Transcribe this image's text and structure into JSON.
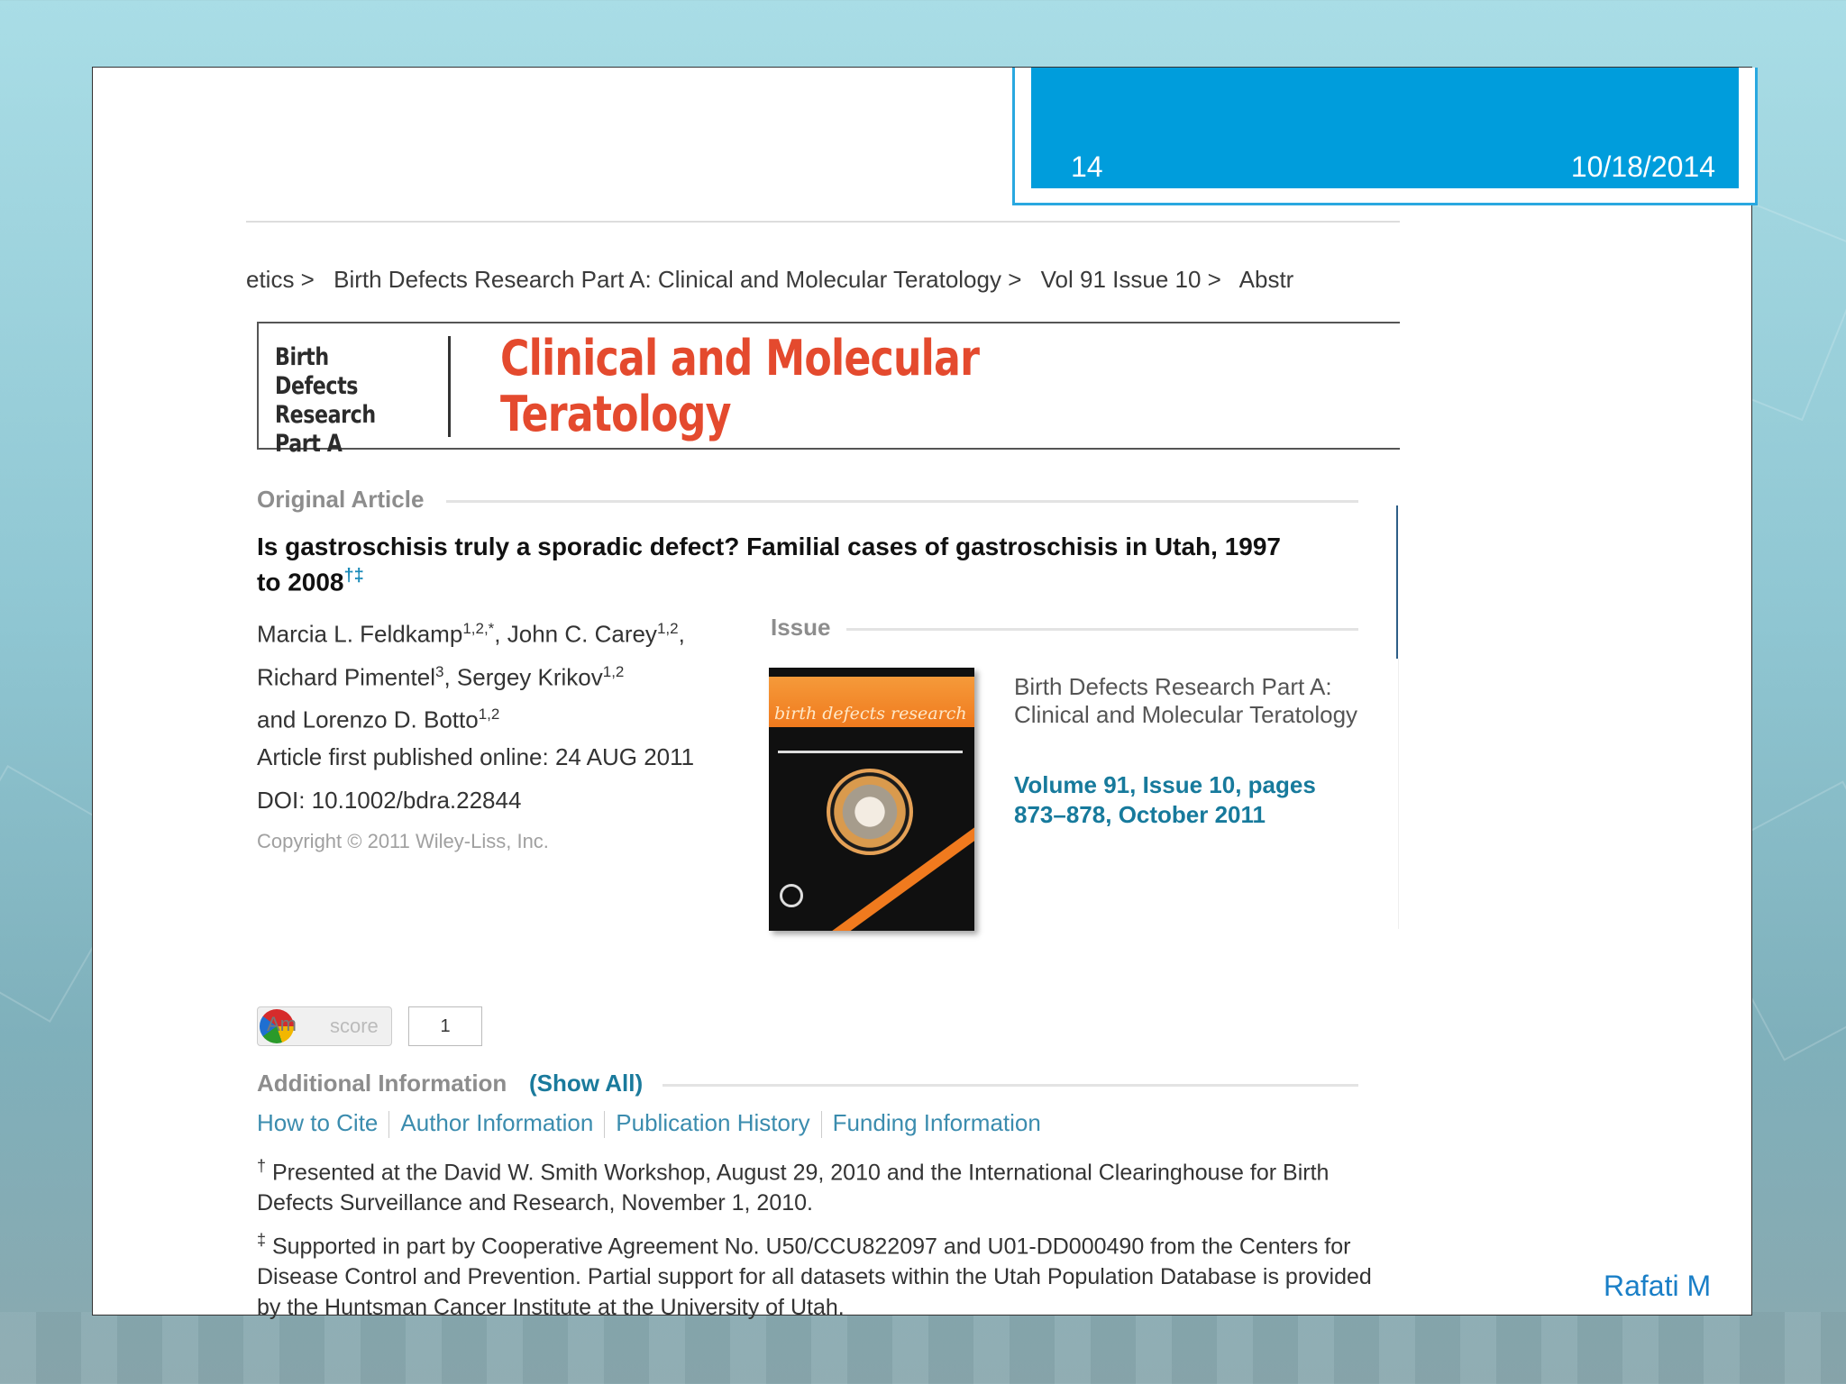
{
  "slide": {
    "number": "14",
    "date": "10/18/2014",
    "footer": "Rafati M"
  },
  "breadcrumb": [
    "etics >",
    "Birth Defects Research Part A: Clinical and Molecular Teratology >",
    "Vol 91 Issue 10 >",
    "Abstr"
  ],
  "banner": {
    "left_lines": [
      "Birth Defects",
      "Research",
      "Part A"
    ],
    "title_lines": [
      "Clinical and Molecular",
      "Teratology"
    ]
  },
  "article": {
    "section_label": "Original Article",
    "title": "Is gastroschisis truly a sporadic defect? Familial cases of gastroschisis in Utah, 1997 to 2008",
    "title_marks": "†‡",
    "authors": [
      {
        "name": "Marcia L. Feldkamp",
        "sup": "1,2,*",
        "suffix": ", "
      },
      {
        "name": "John C. Carey",
        "sup": "1,2",
        "suffix": ","
      },
      {
        "name": "Richard Pimentel",
        "sup": "3",
        "suffix": ", "
      },
      {
        "name": "Sergey Krikov",
        "sup": "1,2",
        "suffix": ""
      },
      {
        "name": "and Lorenzo D. Botto",
        "sup": "1,2",
        "suffix": ""
      }
    ],
    "published": "Article first published online: 24 AUG 2011",
    "doi": "DOI: 10.1002/bdra.22844",
    "copyright": "Copyright © 2011 Wiley-Liss, Inc."
  },
  "issue": {
    "label": "Issue",
    "cover_text": "birth defects research",
    "journal": "Birth Defects Research Part A: Clinical and Molecular Teratology",
    "volume_link": "Volume 91",
    "issue_link": "Issue 10",
    "pages_link": "pages 873–878",
    "date_link": "October 2011"
  },
  "altmetric": {
    "badge": "Am",
    "score_label": "score",
    "score": "1"
  },
  "additional": {
    "label": "Additional Information",
    "show_all": "(Show All)",
    "tabs": [
      "How to Cite",
      "Author Information",
      "Publication History",
      "Funding Information"
    ],
    "notes": [
      {
        "mark": "†",
        "text": "Presented at the David W. Smith Workshop, August 29, 2010 and the International Clearinghouse for Birth Defects Surveillance and Research, November 1, 2010."
      },
      {
        "mark": "‡",
        "text": "Supported in part by Cooperative Agreement No. U50/CCU822097 and U01-DD000490 from the Centers for Disease Control and Prevention. Partial support for all datasets within the Utah Population Database is provided by the Huntsman Cancer Institute at the University of Utah."
      }
    ]
  }
}
